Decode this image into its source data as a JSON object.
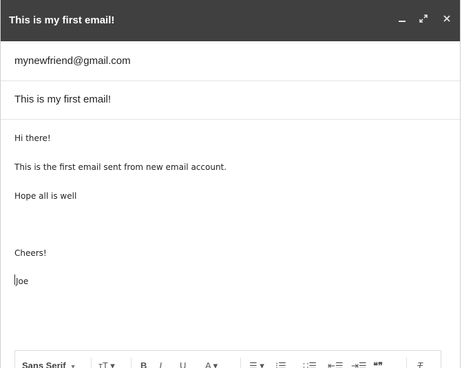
{
  "window": {
    "title": "This is my first email!",
    "controls": {
      "minimize": "minimize-icon",
      "expand": "expand-icon",
      "close": "close-icon"
    },
    "titlebar_color": "#404040"
  },
  "fields": {
    "to": "mynewfriend@gmail.com",
    "subject": "This is my first email!"
  },
  "message": {
    "lines": [
      "Hi there!",
      "This is the first email sent from new email account.",
      "Hope all is well",
      "",
      "Cheers!",
      "Joe"
    ]
  },
  "toolbar": {
    "font": "Sans Serif",
    "size_icon": "text-size-icon",
    "bold": "B",
    "italic": "I",
    "underline": "U",
    "text_color": "A",
    "clear_formatting": "T"
  }
}
